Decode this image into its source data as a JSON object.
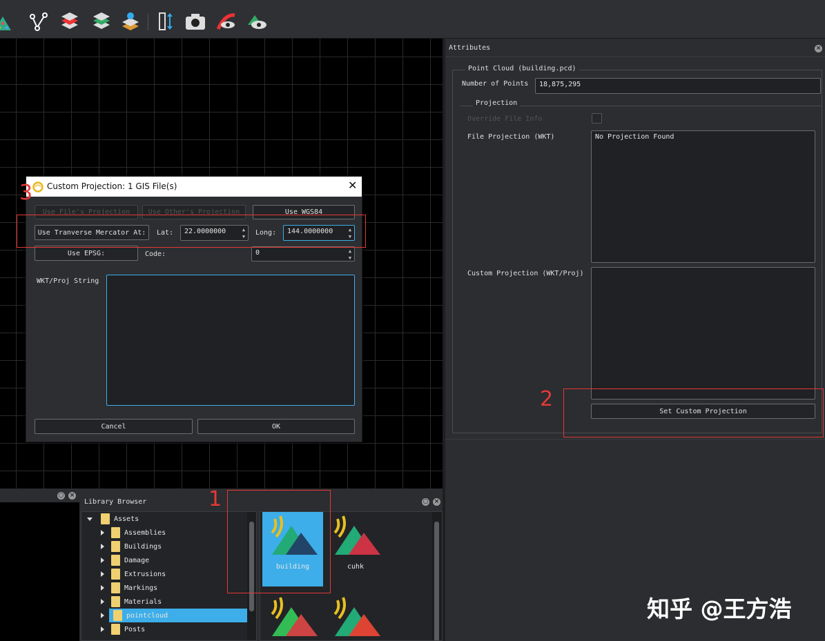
{
  "toolbar": {
    "icons": [
      "point-cloud-tool-icon",
      "vector-path-icon",
      "road-layer-icon",
      "road-stack-icon",
      "map-pin-layer-icon",
      "measure-icon",
      "camera-icon",
      "road-view-icon",
      "terrain-view-icon"
    ]
  },
  "attributes": {
    "title": "Attributes",
    "point_cloud_group": "Point Cloud (building.pcd)",
    "num_points_label": "Number of Points",
    "num_points_value": "18,875,295",
    "projection_group": "Projection",
    "override_label": "Override File Info",
    "file_projection_label": "File Projection (WKT)",
    "file_projection_value": "No Projection Found",
    "custom_projection_label": "Custom Projection (WKT/Proj)",
    "custom_projection_value": "",
    "set_custom_button": "Set Custom Projection"
  },
  "dialog": {
    "title": "Custom Projection: 1 GIS File(s)",
    "btn_use_file": "Use File's Projection",
    "btn_use_other": "Use Other's Projection",
    "btn_use_wgs84": "Use WGS84",
    "btn_use_tm": "Use Tranverse Mercator At:",
    "lat_label": "Lat:",
    "lat_value": "22.0000000",
    "long_label": "Long:",
    "long_value": "144.0000000",
    "btn_use_epsg": "Use EPSG:",
    "code_label": "Code:",
    "code_value": "0",
    "wkt_label": "WKT/Proj String",
    "wkt_value": "",
    "cancel": "Cancel",
    "ok": "OK"
  },
  "library": {
    "title": "Library Browser",
    "root": "Assets",
    "folders": [
      "Assemblies",
      "Buildings",
      "Damage",
      "Extrusions",
      "Markings",
      "Materials",
      "pointcloud",
      "Posts"
    ],
    "selected_folder": "pointcloud",
    "assets": [
      "building",
      "cuhk"
    ],
    "selected_asset": "building"
  },
  "annotations": {
    "box1": "1",
    "box2": "2",
    "box3": "3"
  },
  "watermark": "知乎 @王方浩",
  "colors": {
    "accent": "#3daee9",
    "annotation_red": "#e53935",
    "folder": "#f0d070"
  }
}
